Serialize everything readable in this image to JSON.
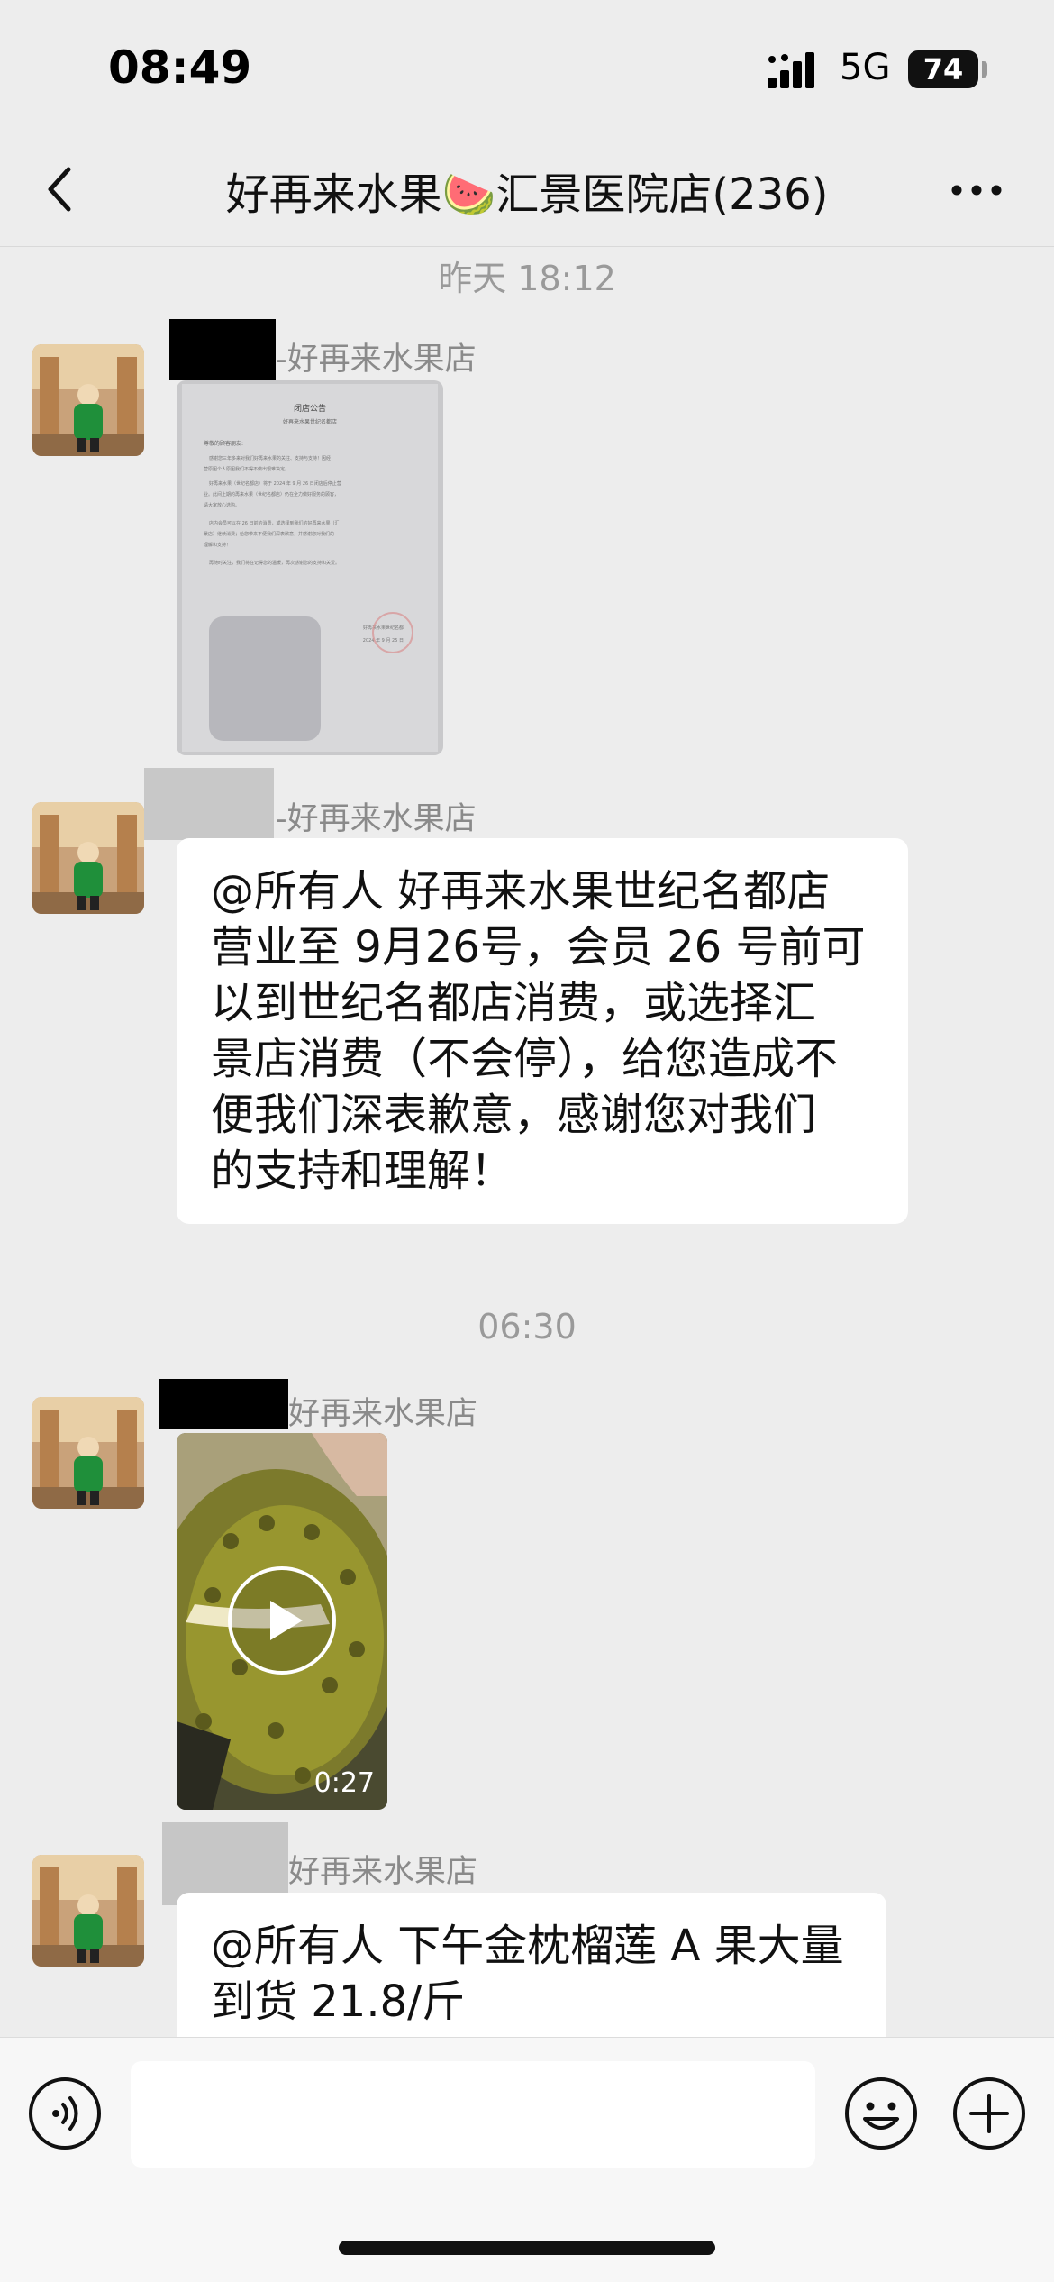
{
  "status_bar": {
    "time": "08:49",
    "network": "5G",
    "battery": "74"
  },
  "nav": {
    "title": "好再来水果🍉汇景医院店(236)"
  },
  "chat": {
    "timestamps": [
      "昨天 18:12",
      "06:30"
    ],
    "messages": [
      {
        "type": "image",
        "sender": "-好再来水果店",
        "image_label": "notice-document",
        "doc_title": "闭店公告",
        "doc_subtitle": "好再来水果世纪名都店",
        "doc_greeting": "尊敬的顾客朋友:",
        "doc_lines": [
          "感谢您三年多来对我们好再来水果的关注、支持与支持！因经",
          "营原因个人原因我们不得不做出艰难决定。",
          "好再来水果（世纪名都店）将于 2024 年 9 月 26 日闭店后停止营",
          "业。此间上期的再来水果（世纪名都店）仍在全力做好服务的顾客，",
          "请大家放心选购。",
          "店内会员可以在 26 日前的消费，或选择到我们的好再来水果（汇",
          "景店）继续消费；给您带来不便我们深表歉意，并感谢您对我们的",
          "理解和支持！",
          "再随时关注，我们将在记得您的温暖，再次感谢您的支持和关爱。"
        ],
        "doc_signature": "好再来水果世纪名都",
        "doc_date": "2024 年 9 月 25 日"
      },
      {
        "type": "text",
        "sender": "-好再来水果店",
        "lines": [
          "@所有人 好再来水果世纪名都店",
          "营业至 9月26号，会员 26 号前可",
          "以到世纪名都店消费，或选择汇",
          "景店消费（不会停），给您造成不",
          "便我们深表歉意，感谢您对我们",
          "的支持和理解！"
        ]
      },
      {
        "type": "video",
        "sender": "好再来水果店",
        "duration": "0:27"
      },
      {
        "type": "text",
        "sender": "好再来水果店",
        "lines": [
          "@所有人 下午金枕榴莲 A 果大量",
          "到货 21.8/斤"
        ]
      }
    ]
  },
  "input_bar": {
    "placeholder": ""
  },
  "colors": {
    "background": "#ededed",
    "bubble": "#ffffff",
    "timestamp": "#9a9a9a",
    "sender_name": "#8a8a8a"
  },
  "icons": [
    "back-icon",
    "more-icon",
    "voice-icon",
    "emoji-icon",
    "plus-icon",
    "play-icon",
    "signal-icon",
    "battery-icon"
  ]
}
